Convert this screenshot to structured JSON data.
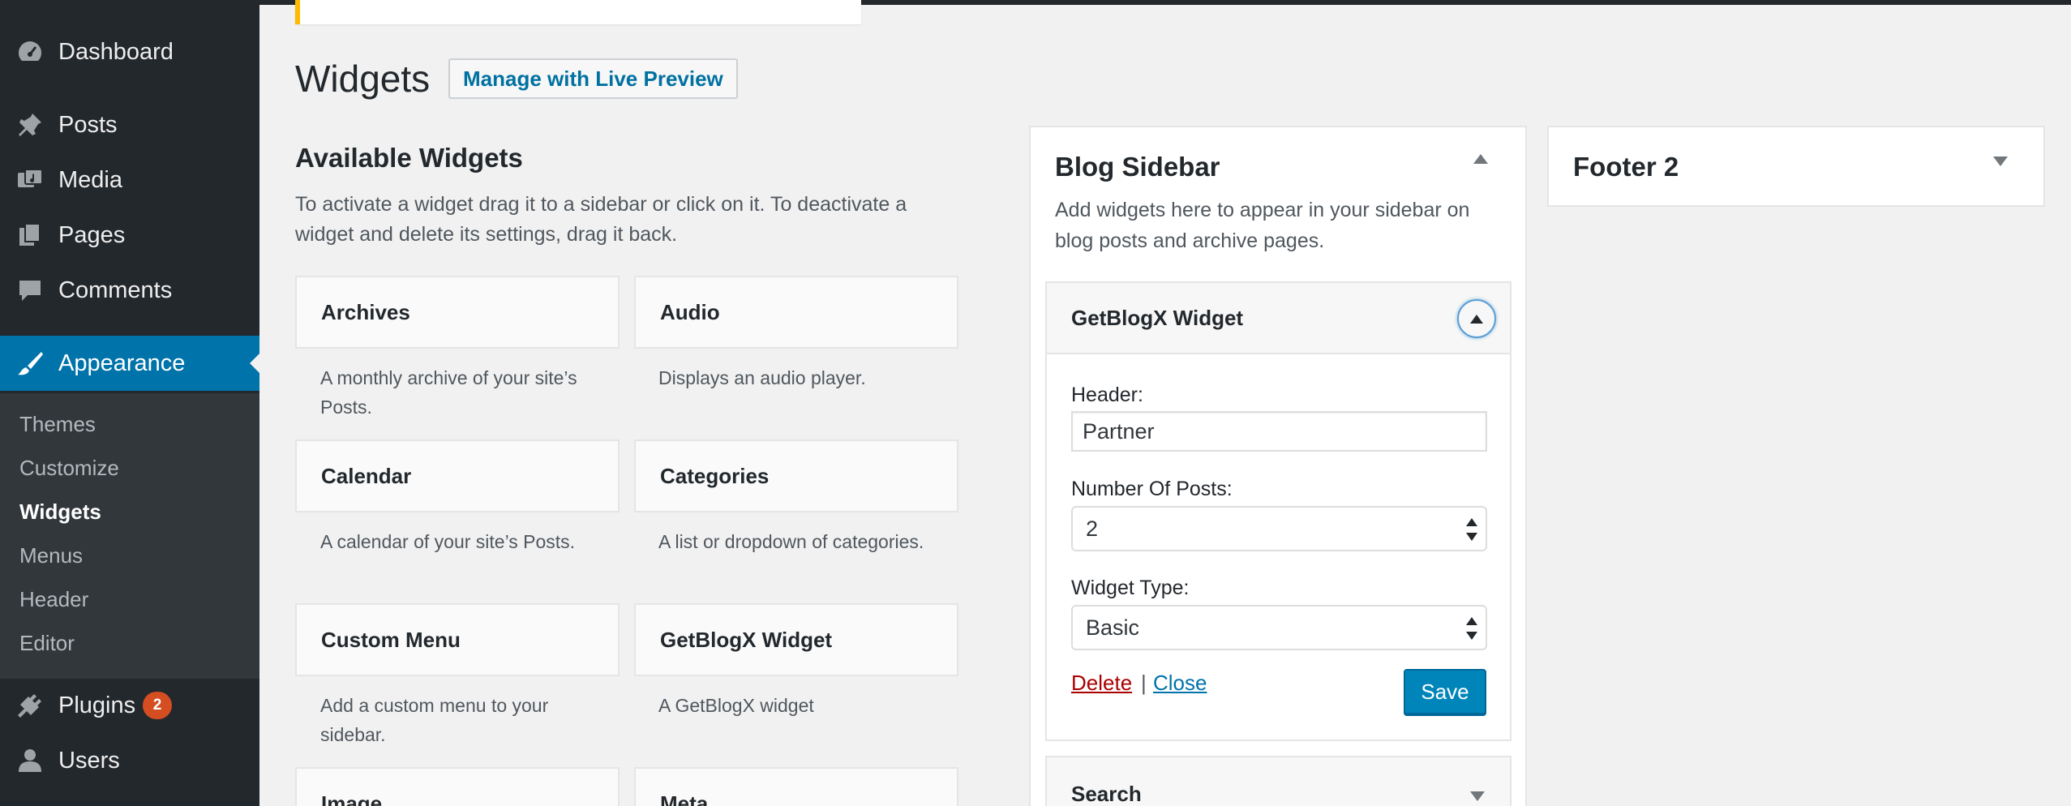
{
  "sidebar": {
    "menu": {
      "dashboard": "Dashboard",
      "posts": "Posts",
      "media": "Media",
      "pages": "Pages",
      "comments": "Comments",
      "appearance": "Appearance",
      "plugins": "Plugins",
      "plugins_badge": "2",
      "users": "Users"
    },
    "submenu": {
      "themes": "Themes",
      "customize": "Customize",
      "widgets": "Widgets",
      "menus": "Menus",
      "header": "Header",
      "editor": "Editor"
    }
  },
  "page": {
    "title": "Widgets",
    "live_preview": "Manage with Live Preview"
  },
  "available": {
    "title": "Available Widgets",
    "description": "To activate a widget drag it to a sidebar or click on it. To deactivate a widget and delete its settings, drag it back.",
    "widgets": [
      {
        "name": "Archives",
        "desc": "A monthly archive of your site’s Posts."
      },
      {
        "name": "Audio",
        "desc": "Displays an audio player."
      },
      {
        "name": "Calendar",
        "desc": "A calendar of your site’s Posts."
      },
      {
        "name": "Categories",
        "desc": "A list or dropdown of categories."
      },
      {
        "name": "Custom Menu",
        "desc": "Add a custom menu to your sidebar."
      },
      {
        "name": "GetBlogX Widget",
        "desc": "A GetBlogX widget"
      },
      {
        "name": "Image",
        "desc": ""
      },
      {
        "name": "Meta",
        "desc": ""
      }
    ]
  },
  "blog_sidebar": {
    "title": "Blog Sidebar",
    "description": "Add widgets here to appear in your sidebar on blog posts and archive pages.",
    "widget": {
      "title": "GetBlogX Widget",
      "header_label": "Header:",
      "header_value": "Partner",
      "posts_label": "Number Of Posts:",
      "posts_value": "2",
      "type_label": "Widget Type:",
      "type_value": "Basic",
      "delete": "Delete",
      "separator": "|",
      "close": "Close",
      "save": "Save"
    },
    "search_widget": "Search"
  },
  "footer2": {
    "title": "Footer 2"
  },
  "colors": {
    "sidebar_bg": "#23282d",
    "active_blue": "#0073aa",
    "badge": "#d54e21",
    "save_button": "#0085ba",
    "delete_link": "#aa0000",
    "notice_accent": "#ffb900"
  }
}
